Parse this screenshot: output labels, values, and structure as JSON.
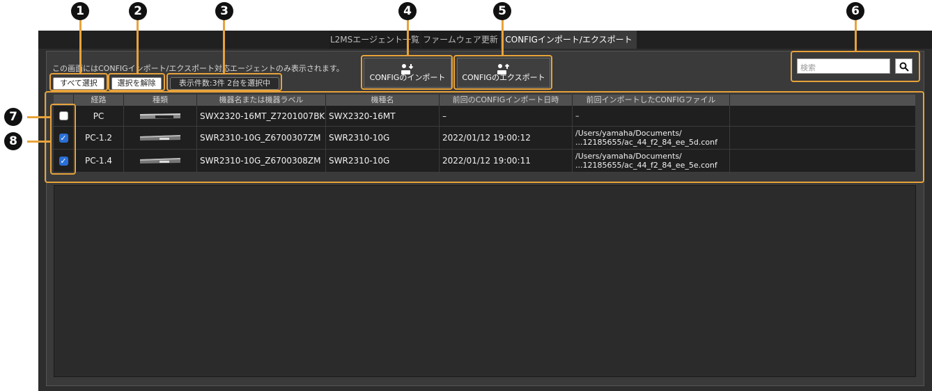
{
  "tabs": [
    {
      "label": "L2MSエージェント一覧"
    },
    {
      "label": "ファームウェア更新"
    },
    {
      "label": "CONFIGインポート/エクスポート"
    }
  ],
  "info_text": "この画面にはCONFIGインポート/エクスポート対応エージェントのみ表示されます。",
  "buttons": {
    "select_all": "すべて選択",
    "deselect": "選択を解除",
    "count_status": "表示件数:3件 2台を選択中",
    "import": "CONFIGのインポート",
    "export": "CONFIGのエクスポート"
  },
  "search": {
    "placeholder": "検索"
  },
  "callouts": [
    "1",
    "2",
    "3",
    "4",
    "5",
    "6",
    "7",
    "8"
  ],
  "table": {
    "columns": [
      "経路",
      "種類",
      "機器名または機器ラベル",
      "機種名",
      "前回のCONFIGインポート日時",
      "前回インポートしたCONFIGファイル"
    ],
    "rows": [
      {
        "checked": false,
        "route": "PC",
        "device_image": "switch-16port",
        "name": "SWX2320-16MT_Z7201007BK",
        "model": "SWX2320-16MT",
        "last_import": "–",
        "file_line1": "–",
        "file_line2": ""
      },
      {
        "checked": true,
        "route": "PC-1.2",
        "device_image": "switch-10port",
        "name": "SWR2310-10G_Z6700307ZM",
        "model": "SWR2310-10G",
        "last_import": "2022/01/12 19:00:12",
        "file_line1": "/Users/yamaha/Documents/",
        "file_line2": "...12185655/ac_44_f2_84_ee_5d.conf"
      },
      {
        "checked": true,
        "route": "PC-1.4",
        "device_image": "switch-10port",
        "name": "SWR2310-10G_Z6700308ZM",
        "model": "SWR2310-10G",
        "last_import": "2022/01/12 19:00:11",
        "file_line1": "/Users/yamaha/Documents/",
        "file_line2": "...12185655/ac_44_f2_84_ee_5e.conf"
      }
    ]
  },
  "colors": {
    "highlight": "#e8a33a",
    "checkbox_checked": "#2a6fd6",
    "background": "#2d2d2d"
  }
}
